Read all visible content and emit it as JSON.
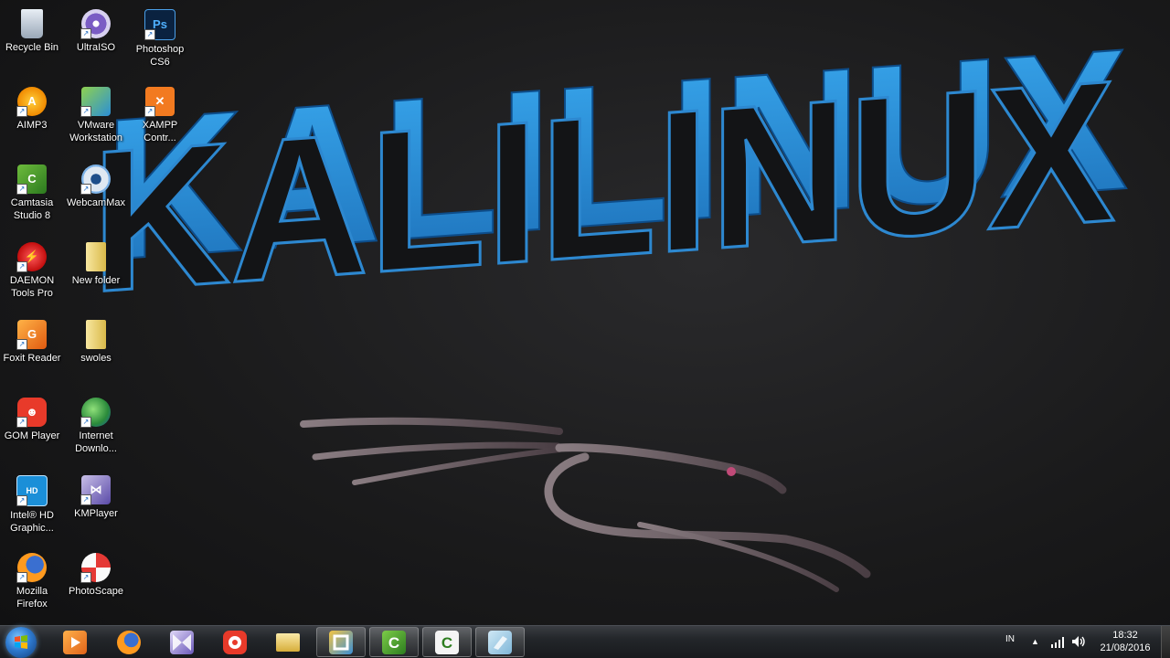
{
  "desktop": {
    "icons": [
      {
        "label": "Recycle Bin",
        "icon": "recycle-bin-icon"
      },
      {
        "label": "UltraISO",
        "icon": "ultraiso-icon"
      },
      {
        "label": "Photoshop CS6",
        "icon": "photoshop-icon"
      },
      {
        "label": "AIMP3",
        "icon": "aimp-icon"
      },
      {
        "label": "VMware Workstation",
        "icon": "vmware-icon"
      },
      {
        "label": "XAMPP Contr...",
        "icon": "xampp-icon"
      },
      {
        "label": "Camtasia Studio 8",
        "icon": "camtasia-icon"
      },
      {
        "label": "WebcamMax",
        "icon": "webcammax-icon"
      },
      {
        "label": "DAEMON Tools Pro",
        "icon": "daemon-tools-icon"
      },
      {
        "label": "New folder",
        "icon": "folder-icon"
      },
      {
        "label": "Foxit Reader",
        "icon": "foxit-icon"
      },
      {
        "label": "swoles",
        "icon": "folder-icon"
      },
      {
        "label": "GOM Player",
        "icon": "gom-player-icon"
      },
      {
        "label": "Internet Downlo...",
        "icon": "idm-icon"
      },
      {
        "label": "Intel® HD Graphic...",
        "icon": "intel-hd-icon"
      },
      {
        "label": "KMPlayer",
        "icon": "kmplayer-icon"
      },
      {
        "label": "Mozilla Firefox",
        "icon": "firefox-icon"
      },
      {
        "label": "PhotoScape",
        "icon": "photoscape-icon"
      }
    ]
  },
  "wallpaper": {
    "text": "KALILINUX",
    "accent": "#2f9be6"
  },
  "taskbar": {
    "pinned": [
      {
        "name": "media-player-icon",
        "active": false
      },
      {
        "name": "firefox-icon",
        "active": false
      },
      {
        "name": "kmplayer-icon",
        "active": false
      },
      {
        "name": "gom-player-icon",
        "active": false
      },
      {
        "name": "file-explorer-icon",
        "active": false
      },
      {
        "name": "vmware-icon",
        "active": true
      },
      {
        "name": "camtasia-recorder-icon",
        "active": true
      },
      {
        "name": "camtasia-studio-icon",
        "active": true
      },
      {
        "name": "screen-capture-icon",
        "active": true
      }
    ],
    "tray": {
      "language": "IN",
      "time": "18:32",
      "date": "21/08/2016"
    }
  }
}
